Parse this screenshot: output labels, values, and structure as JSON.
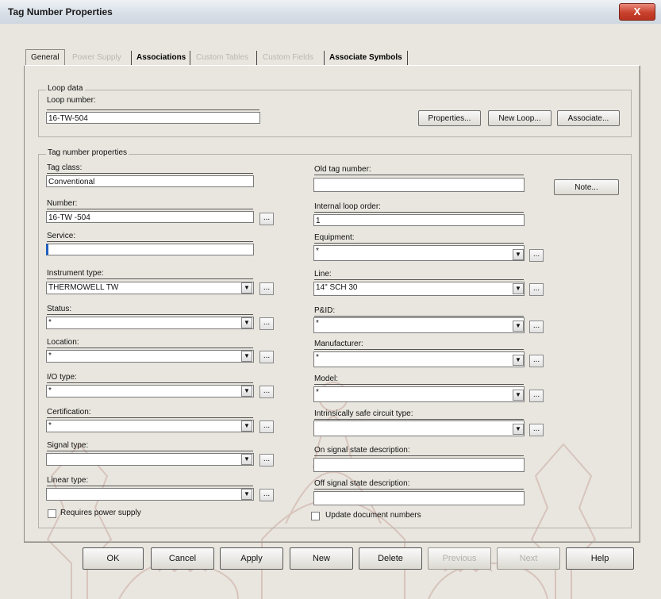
{
  "window": {
    "title": "Tag Number Properties",
    "close_label": "X"
  },
  "tabs": [
    {
      "label": "General",
      "enabled": true
    },
    {
      "label": "Power Supply",
      "enabled": false
    },
    {
      "label": "Associations",
      "enabled": true
    },
    {
      "label": "Custom Tables",
      "enabled": false
    },
    {
      "label": "Custom Fields",
      "enabled": false
    },
    {
      "label": "Associate Symbols",
      "enabled": true
    }
  ],
  "loop": {
    "group_label": "Loop data",
    "number_label": "Loop number:",
    "number_value": "16-TW-504",
    "properties_btn": "Properties...",
    "new_loop_btn": "New Loop...",
    "associate_btn": "Associate..."
  },
  "tag": {
    "group_label": "Tag number properties",
    "tag_class_label": "Tag class:",
    "tag_class_value": "Conventional",
    "number_label": "Number:",
    "number_value": "16-TW -504",
    "service_label": "Service:",
    "service_value": "",
    "instrument_type_label": "Instrument type:",
    "instrument_type_value": "THERMOWELL      TW",
    "status_label": "Status:",
    "status_value": "*",
    "location_label": "Location:",
    "location_value": "*",
    "io_type_label": "I/O type:",
    "io_type_value": "*",
    "certification_label": "Certification:",
    "certification_value": "*",
    "signal_type_label": "Signal type:",
    "signal_type_value": "",
    "linear_type_label": "Linear type:",
    "linear_type_value": "",
    "requires_power_label": "Requires power supply",
    "old_tag_label": "Old tag number:",
    "old_tag_value": "",
    "note_btn": "Note...",
    "internal_loop_label": "Internal loop order:",
    "internal_loop_value": "1",
    "equipment_label": "Equipment:",
    "equipment_value": "*",
    "line_label": "Line:",
    "line_value": "14\" SCH 30",
    "pid_label": "P&ID:",
    "pid_value": "*",
    "manufacturer_label": "Manufacturer:",
    "manufacturer_value": "*",
    "model_label": "Model:",
    "model_value": "*",
    "intrinsic_label": "Intrinsically safe circuit type:",
    "intrinsic_value": "",
    "on_signal_label": "On signal state description:",
    "on_signal_value": "",
    "off_signal_label": "Off signal state description:",
    "off_signal_value": "",
    "update_docs_label": "Update document numbers",
    "ellipsis": "...",
    "arrow": "▼"
  },
  "buttons": [
    {
      "label": "OK",
      "enabled": true
    },
    {
      "label": "Cancel",
      "enabled": true
    },
    {
      "label": "Apply",
      "enabled": true
    },
    {
      "label": "New",
      "enabled": true
    },
    {
      "label": "Delete",
      "enabled": true
    },
    {
      "label": "Previous",
      "enabled": false
    },
    {
      "label": "Next",
      "enabled": false
    },
    {
      "label": "Help",
      "enabled": true
    }
  ],
  "colors": {
    "dialog_bg": "#e9e6df",
    "close_red": "#c8412c",
    "watermark": "#c9a9a0"
  },
  "icons": {
    "close": "close-icon",
    "dropdown": "chevron-down-icon",
    "watermark": "university-emblem-watermark"
  }
}
